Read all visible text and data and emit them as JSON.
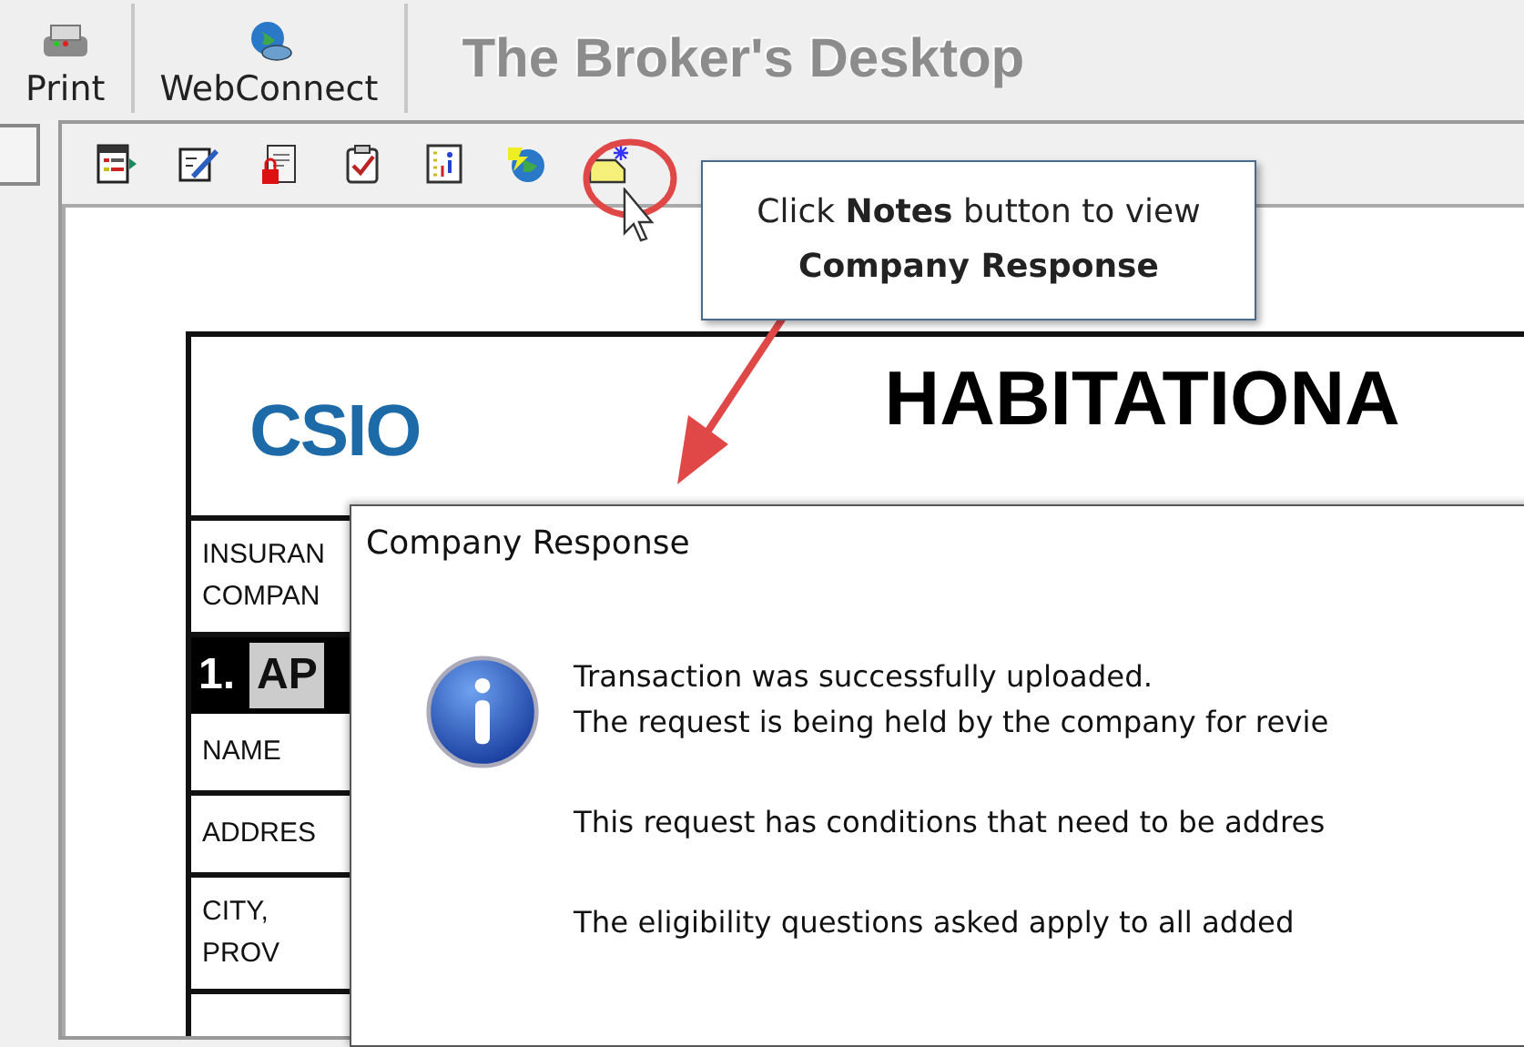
{
  "toolbar": {
    "buttons": [
      {
        "label": "Print",
        "kind": "printer"
      },
      {
        "label": "WebConnect",
        "kind": "globe"
      }
    ],
    "title": "The Broker's Desktop"
  },
  "doc_toolbar": {
    "icons": [
      {
        "kind": "list"
      },
      {
        "kind": "edit"
      },
      {
        "kind": "locked-doc"
      },
      {
        "kind": "clipboard"
      },
      {
        "kind": "info-doc"
      },
      {
        "kind": "globe-map"
      },
      {
        "kind": "note"
      }
    ]
  },
  "callout": {
    "text": "Click **Notes** button to view **Company Response**"
  },
  "form": {
    "logo": "CSIO",
    "title": "HABITATIONA",
    "rows": [
      {
        "kind": "label",
        "lines": [
          "INSURAN",
          "COMPAN"
        ]
      },
      {
        "kind": "section",
        "number": "1.",
        "label": "AP"
      },
      {
        "kind": "label",
        "lines": [
          "NAME"
        ]
      },
      {
        "kind": "label",
        "lines": [
          "ADDRES"
        ]
      },
      {
        "kind": "label",
        "lines": [
          "CITY,",
          "PROV"
        ]
      }
    ]
  },
  "dialog": {
    "title": "Company Response",
    "paragraphs": [
      [
        "Transaction was successfully uploaded.",
        "The request is being held by the company for revie"
      ],
      [
        "This request has conditions that need to be addres"
      ],
      [
        "The eligibility questions asked apply to all added"
      ]
    ]
  }
}
